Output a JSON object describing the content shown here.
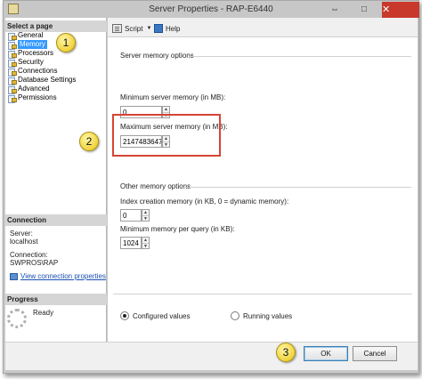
{
  "window": {
    "title": "Server Properties - RAP-E6440",
    "pin_glyph": "⇔",
    "minimize_glyph": "□",
    "close_glyph": "✕"
  },
  "left": {
    "select_page_header": "Select a page",
    "pages": [
      {
        "label": "General",
        "selected": false
      },
      {
        "label": "Memory",
        "selected": true
      },
      {
        "label": "Processors",
        "selected": false
      },
      {
        "label": "Security",
        "selected": false
      },
      {
        "label": "Connections",
        "selected": false
      },
      {
        "label": "Database Settings",
        "selected": false
      },
      {
        "label": "Advanced",
        "selected": false
      },
      {
        "label": "Permissions",
        "selected": false
      }
    ],
    "connection_header": "Connection",
    "server_label": "Server:",
    "server_value": "localhost",
    "connection_label": "Connection:",
    "connection_value": "SWPROS\\RAP",
    "view_link": "View connection properties",
    "progress_header": "Progress",
    "progress_status": "Ready"
  },
  "toolbar": {
    "script_label": "Script",
    "help_label": "Help"
  },
  "memory": {
    "server_group_label": "Server memory options",
    "min_label": "Minimum server memory (in MB):",
    "min_value": "0",
    "max_label": "Maximum server memory (in MB):",
    "max_value": "2147483647",
    "other_group_label": "Other memory options",
    "index_label": "Index creation memory (in KB, 0 = dynamic memory):",
    "index_value": "0",
    "query_label": "Minimum memory per query (in KB):",
    "query_value": "1024",
    "configured_label": "Configured values",
    "running_label": "Running values"
  },
  "buttons": {
    "ok": "OK",
    "cancel": "Cancel"
  },
  "callouts": [
    "1",
    "2",
    "3"
  ],
  "colors": {
    "highlight": "#d64535",
    "selection": "#3399ff",
    "close": "#c8392b",
    "callout": "#f1d23a"
  }
}
